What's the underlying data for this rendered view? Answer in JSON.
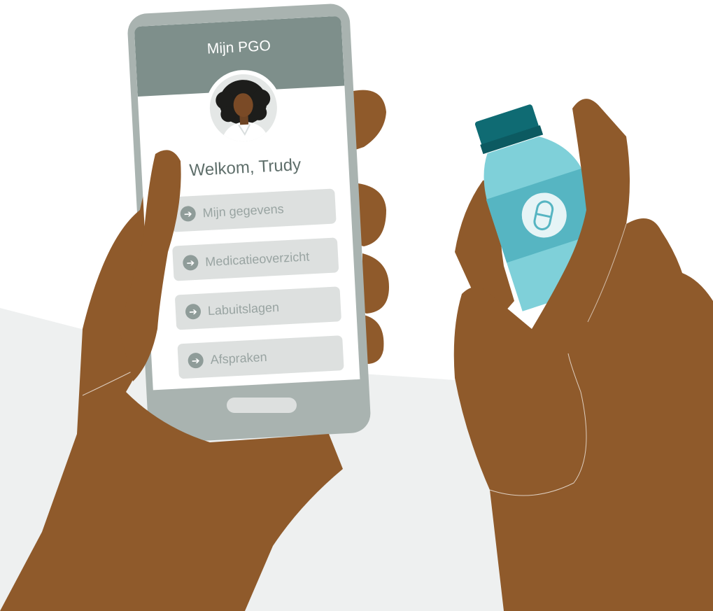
{
  "app": {
    "title": "Mijn PGO",
    "welcome": "Welkom, Trudy"
  },
  "menu": {
    "items": [
      {
        "label": "Mijn gegevens",
        "icon": "arrow-right-circle-icon"
      },
      {
        "label": "Medicatieoverzicht",
        "icon": "arrow-right-circle-icon"
      },
      {
        "label": "Labuitslagen",
        "icon": "arrow-right-circle-icon"
      },
      {
        "label": "Afspraken",
        "icon": "arrow-right-circle-icon"
      }
    ]
  },
  "colors": {
    "skin": "#8f5a2b",
    "phone_frame": "#a9b3b0",
    "header": "#7e8f8b",
    "button_bg": "#dde0df",
    "bottle_body": "#7fd0d9",
    "bottle_band": "#56b5c2",
    "bottle_cap": "#0f6b73",
    "background_floor": "#eef0f0"
  },
  "icons": {
    "avatar": "user-avatar-woman",
    "bottle_label": "pill-capsule-icon",
    "home_button": "home-button"
  }
}
